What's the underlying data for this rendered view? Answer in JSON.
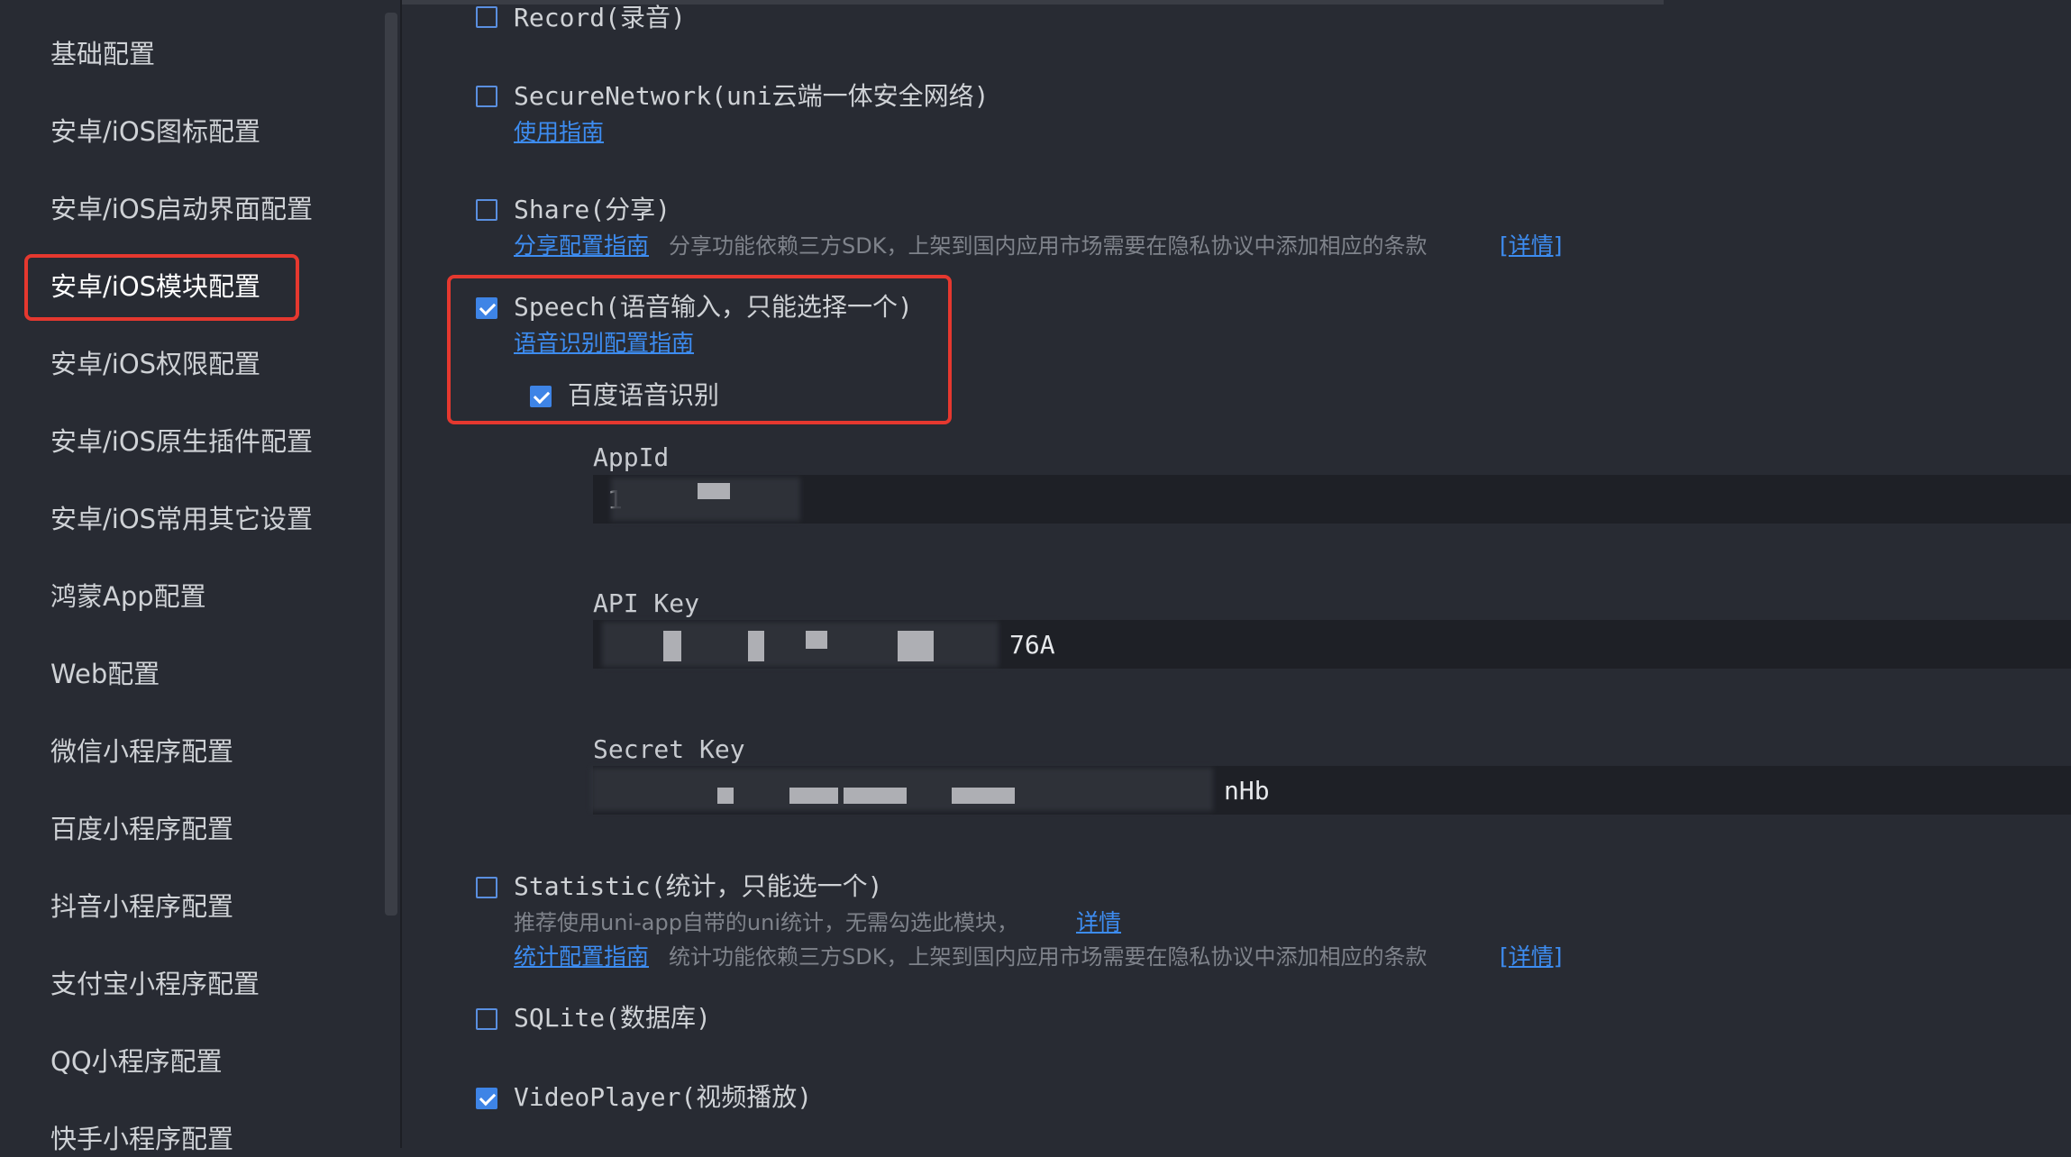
{
  "sidebar": {
    "items": [
      {
        "label": "基础配置"
      },
      {
        "label": "安卓/iOS图标配置"
      },
      {
        "label": "安卓/iOS启动界面配置"
      },
      {
        "label": "安卓/iOS模块配置"
      },
      {
        "label": "安卓/iOS权限配置"
      },
      {
        "label": "安卓/iOS原生插件配置"
      },
      {
        "label": "安卓/iOS常用其它设置"
      },
      {
        "label": "鸿蒙App配置"
      },
      {
        "label": "Web配置"
      },
      {
        "label": "微信小程序配置"
      },
      {
        "label": "百度小程序配置"
      },
      {
        "label": "抖音小程序配置"
      },
      {
        "label": "支付宝小程序配置"
      },
      {
        "label": "QQ小程序配置"
      },
      {
        "label": "快手小程序配置"
      }
    ]
  },
  "modules": {
    "record": {
      "label": "Record(录音)",
      "checked": false
    },
    "secure_network": {
      "label": "SecureNetwork(uni云端一体安全网络)",
      "link": "使用指南",
      "checked": false
    },
    "share": {
      "label": "Share(分享)",
      "link": "分享配置指南",
      "hint": "分享功能依赖三方SDK，上架到国内应用市场需要在隐私协议中添加相应的条款",
      "detail_link": "[详情]",
      "checked": false
    },
    "speech": {
      "label": "Speech(语音输入，只能选择一个)",
      "link": "语音识别配置指南",
      "checked": true,
      "baidu": {
        "label": "百度语音识别",
        "checked": true
      },
      "fields": {
        "appid_label": "AppId",
        "appid_value": "1",
        "apikey_label": "API Key",
        "apikey_value": "76A",
        "secretkey_label": "Secret Key",
        "secretkey_value": "nHb"
      }
    },
    "statistic": {
      "label": "Statistic(统计，只能选一个)",
      "hint1": "推荐使用uni-app自带的uni统计，无需勾选此模块，",
      "hint1_link": "详情",
      "link": "统计配置指南",
      "hint": "统计功能依赖三方SDK，上架到国内应用市场需要在隐私协议中添加相应的条款",
      "detail_link": "[详情]",
      "checked": false
    },
    "sqlite": {
      "label": "SQLite(数据库)",
      "checked": false
    },
    "videoplayer": {
      "label": "VideoPlayer(视频播放)",
      "checked": true
    }
  }
}
